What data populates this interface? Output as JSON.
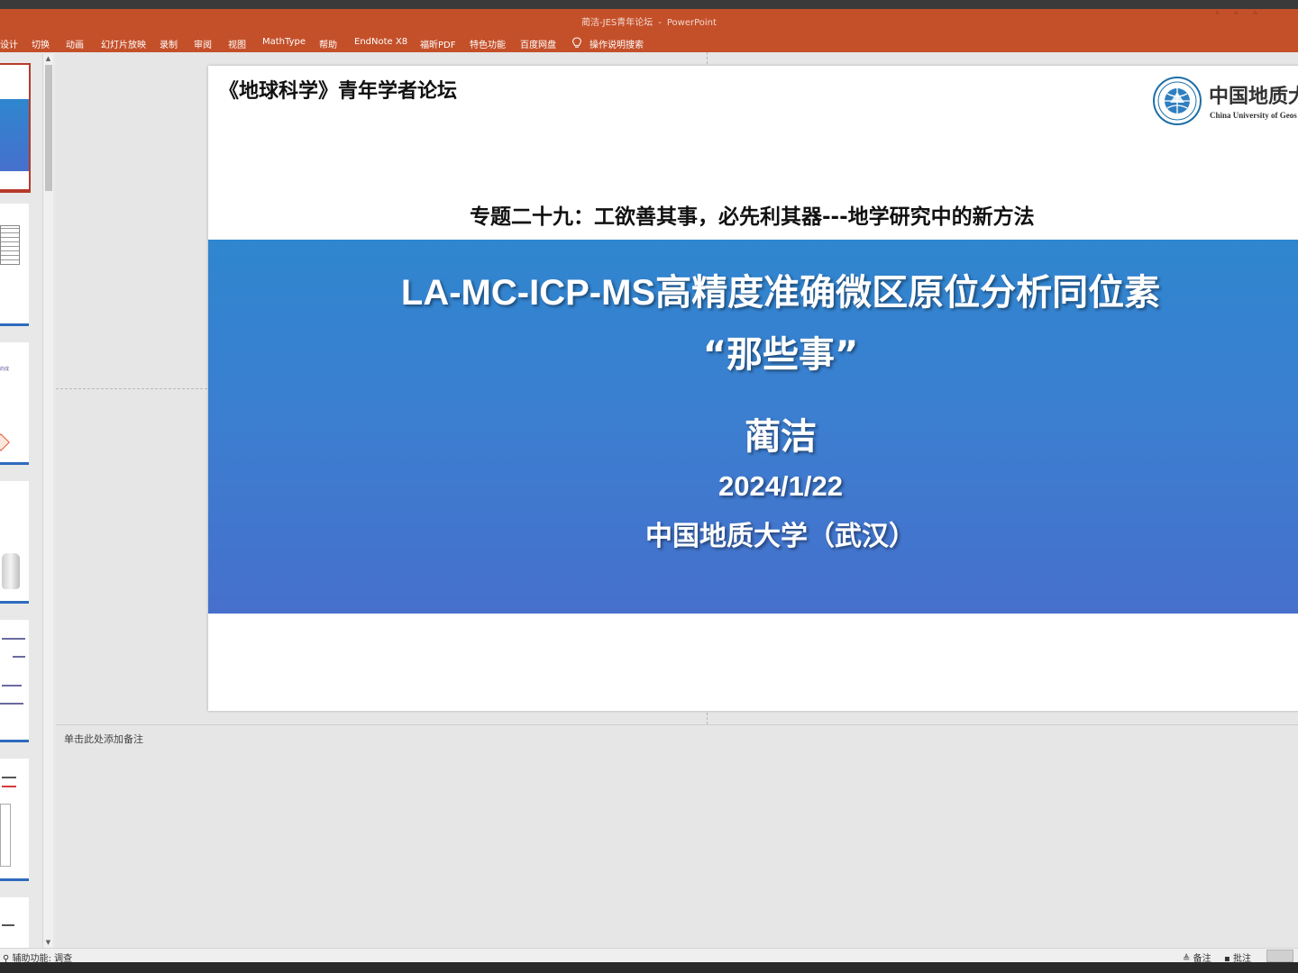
{
  "window": {
    "title": "蔺洁-JES青年论坛",
    "app": "PowerPoint"
  },
  "ribbon": {
    "tabs": [
      "设计",
      "切换",
      "动画",
      "幻灯片放映",
      "录制",
      "审阅",
      "视图",
      "MathType",
      "帮助",
      "EndNote X8",
      "福昕PDF",
      "特色功能",
      "百度网盘"
    ],
    "tell_me": "操作说明搜索"
  },
  "thumbnails": {
    "count_visible": 7,
    "active_index": 0,
    "snippets": [
      "",
      "",
      "的成",
      "",
      "",
      "",
      "",
      "",
      "",
      "",
      "",
      "",
      "",
      "",
      ""
    ]
  },
  "slide": {
    "forum_title": "《地球科学》青年学者论坛",
    "university_cn": "中国地质大",
    "university_en": "China University of Geos",
    "topic": "专题二十九：工欲善其事，必先利其器---地学研究中的新方法",
    "main_title": "LA-MC-ICP-MS高精度准确微区原位分析同位素",
    "sub_title": "“那些事”",
    "author": "蔺洁",
    "date": "2024/1/22",
    "affiliation": "中国地质大学（武汉）"
  },
  "notes": {
    "placeholder": "单击此处添加备注"
  },
  "status": {
    "accessibility": "辅助功能: 调查",
    "notes_button": "备注",
    "comments_button": "批注"
  },
  "colors": {
    "ribbon": "#c4502a",
    "band_top": "#2f86cf",
    "band_bottom": "#4670cc",
    "thumb_active_border": "#b73a2a"
  }
}
